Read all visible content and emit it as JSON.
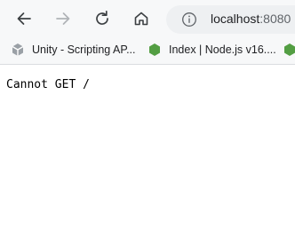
{
  "toolbar": {
    "back_icon": "arrow-left-icon",
    "forward_icon": "arrow-right-icon",
    "reload_icon": "reload-icon",
    "home_icon": "home-icon",
    "site_info_icon": "info-circle-icon"
  },
  "address_bar": {
    "host": "localhost",
    "port": ":8080"
  },
  "bookmarks": [
    {
      "label": "Unity - Scripting AP...",
      "icon": "unity-logo-icon"
    },
    {
      "label": "Index | Node.js v16....",
      "icon": "nodejs-logo-icon"
    },
    {
      "label": "",
      "icon": "nodejs-logo-icon"
    }
  ],
  "page": {
    "body_text": "Cannot GET /"
  },
  "colors": {
    "chrome_bg": "#f7f8f9",
    "address_bg": "#eef0f2",
    "node_green": "#539e43",
    "icon_gray": "#5f6368"
  }
}
